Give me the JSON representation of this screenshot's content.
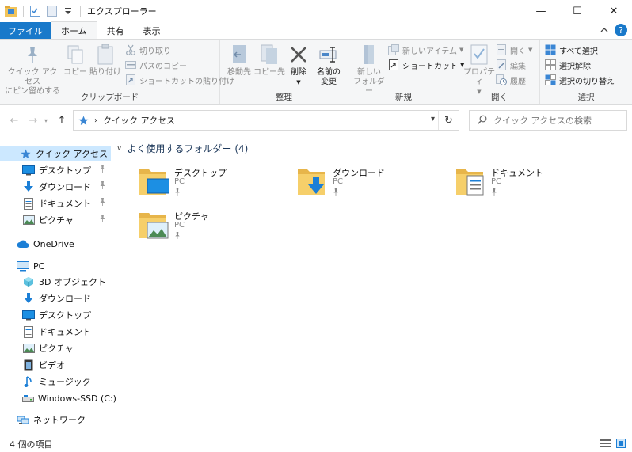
{
  "window": {
    "title": "エクスプローラー",
    "minimize": "—",
    "maximize": "☐",
    "close": "✕"
  },
  "tabs": {
    "file": "ファイル",
    "home": "ホーム",
    "share": "共有",
    "view": "表示"
  },
  "ribbon": {
    "clipboard": {
      "name": "クリップボード",
      "pin_quick_access_1": "クイック アクセス",
      "pin_quick_access_2": "にピン留めする",
      "copy": "コピー",
      "paste": "貼り付け",
      "cut": "切り取り",
      "copy_path": "パスのコピー",
      "paste_shortcut": "ショートカットの貼り付け"
    },
    "organize": {
      "name": "整理",
      "move_to": "移動先",
      "copy_to": "コピー先",
      "delete": "削除",
      "rename_1": "名前の",
      "rename_2": "変更"
    },
    "new": {
      "name": "新規",
      "new_folder_1": "新しい",
      "new_folder_2": "フォルダー",
      "new_item": "新しいアイテム",
      "shortcut": "ショートカット"
    },
    "open": {
      "name": "開く",
      "properties": "プロパティ",
      "open": "開く",
      "edit": "編集",
      "history": "履歴"
    },
    "select": {
      "name": "選択",
      "select_all": "すべて選択",
      "select_none": "選択解除",
      "invert": "選択の切り替え"
    }
  },
  "address": {
    "location": "クイック アクセス",
    "search_placeholder": "クイック アクセスの検索"
  },
  "nav": {
    "quick_access": "クイック アクセス",
    "qa_items": [
      "デスクトップ",
      "ダウンロード",
      "ドキュメント",
      "ピクチャ"
    ],
    "onedrive": "OneDrive",
    "pc": "PC",
    "pc_items": [
      "3D オブジェクト",
      "ダウンロード",
      "デスクトップ",
      "ドキュメント",
      "ピクチャ",
      "ビデオ",
      "ミュージック",
      "Windows-SSD (C:)"
    ],
    "network": "ネットワーク"
  },
  "content": {
    "section_title": "よく使用するフォルダー",
    "section_count": "(4)",
    "folders": [
      {
        "name": "デスクトップ",
        "location": "PC"
      },
      {
        "name": "ダウンロード",
        "location": "PC"
      },
      {
        "name": "ドキュメント",
        "location": "PC"
      },
      {
        "name": "ピクチャ",
        "location": "PC"
      }
    ]
  },
  "status": {
    "item_count": "4 個の項目"
  },
  "colors": {
    "accent": "#1979ca",
    "selection": "#cce8ff",
    "folder": "#f2c45a"
  }
}
